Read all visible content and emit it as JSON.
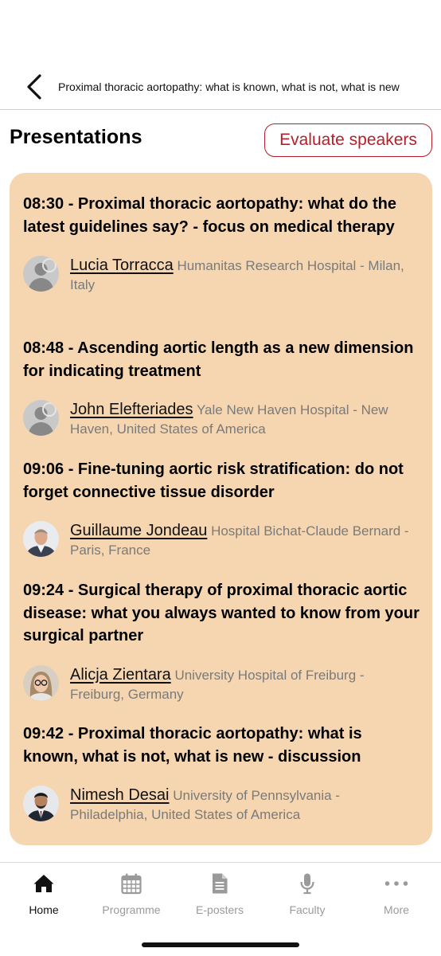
{
  "header": {
    "title": "Proximal thoracic aortopathy: what is known, what is not, what is new"
  },
  "section": {
    "title": "Presentations",
    "evaluate_label": "Evaluate speakers"
  },
  "presentations": [
    {
      "title": "08:30 - Proximal thoracic aortopathy: what do the latest guidelines say? - focus on medical therapy",
      "speaker": {
        "name": "Lucia Torracca",
        "affiliation": "Humanitas Research Hospital - Milan, Italy",
        "avatar": "placeholder-avatar"
      }
    },
    {
      "title": "08:48 - Ascending aortic length as a new dimension for indicating treatment",
      "speaker": {
        "name": "John Elefteriades",
        "affiliation": "Yale New Haven Hospital - New Haven, United States of America",
        "avatar": "placeholder-avatar"
      }
    },
    {
      "title": "09:06 - Fine-tuning aortic risk stratification: do not forget connective tissue disorder",
      "speaker": {
        "name": "Guillaume Jondeau",
        "affiliation": "Hospital Bichat-Claude Bernard - Paris, France",
        "avatar": "photo-avatar"
      }
    },
    {
      "title": "09:24 - Surgical therapy of proximal thoracic aortic disease: what you always wanted to know from your surgical partner",
      "speaker": {
        "name": "Alicja Zientara",
        "affiliation": "University Hospital of Freiburg - Freiburg, Germany",
        "avatar": "photo-avatar"
      }
    },
    {
      "title": "09:42 - Proximal thoracic aortopathy: what is known, what is not, what is new - discussion",
      "speaker": {
        "name": "Nimesh Desai",
        "affiliation": "University of Pennsylvania - Philadelphia, United States of America",
        "avatar": "photo-avatar"
      }
    }
  ],
  "tabbar": {
    "items": [
      {
        "label": "Home",
        "icon": "home-icon",
        "active": true
      },
      {
        "label": "Programme",
        "icon": "calendar-icon",
        "active": false
      },
      {
        "label": "E-posters",
        "icon": "document-icon",
        "active": false
      },
      {
        "label": "Faculty",
        "icon": "microphone-icon",
        "active": false
      },
      {
        "label": "More",
        "icon": "more-icon",
        "active": false
      }
    ]
  },
  "colors": {
    "accent": "#b4202a",
    "card_bg": "#f5d6b0",
    "active_tab": "#111111",
    "inactive_tab": "#9a9a9a"
  }
}
